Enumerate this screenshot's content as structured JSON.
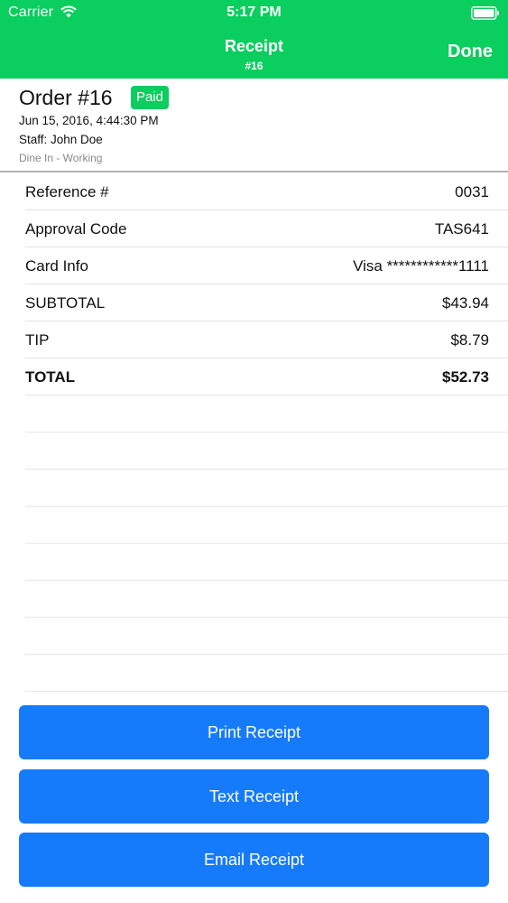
{
  "status_bar": {
    "carrier": "Carrier",
    "time": "5:17 PM",
    "wifi_icon": "wifi-icon",
    "battery_icon": "battery-icon"
  },
  "nav": {
    "title": "Receipt",
    "subtitle": "#16",
    "done_label": "Done"
  },
  "order": {
    "title": "Order #16",
    "badge": "Paid",
    "date": "Jun 15, 2016, 4:44:30 PM",
    "staff": "Staff: John Doe",
    "status": "Dine In - Working"
  },
  "details": [
    {
      "label": "Reference #",
      "value": "0031"
    },
    {
      "label": "Approval Code",
      "value": "TAS641"
    },
    {
      "label": "Card Info",
      "value": "Visa ************1111"
    },
    {
      "label": "SUBTOTAL",
      "value": "$43.94"
    },
    {
      "label": "TIP",
      "value": "$8.79"
    },
    {
      "label": "TOTAL",
      "value": "$52.73"
    }
  ],
  "actions": {
    "print": "Print Receipt",
    "text": "Text Receipt",
    "email": "Email Receipt"
  },
  "colors": {
    "header_green": "#0ace5e",
    "button_blue": "#157bfb"
  }
}
